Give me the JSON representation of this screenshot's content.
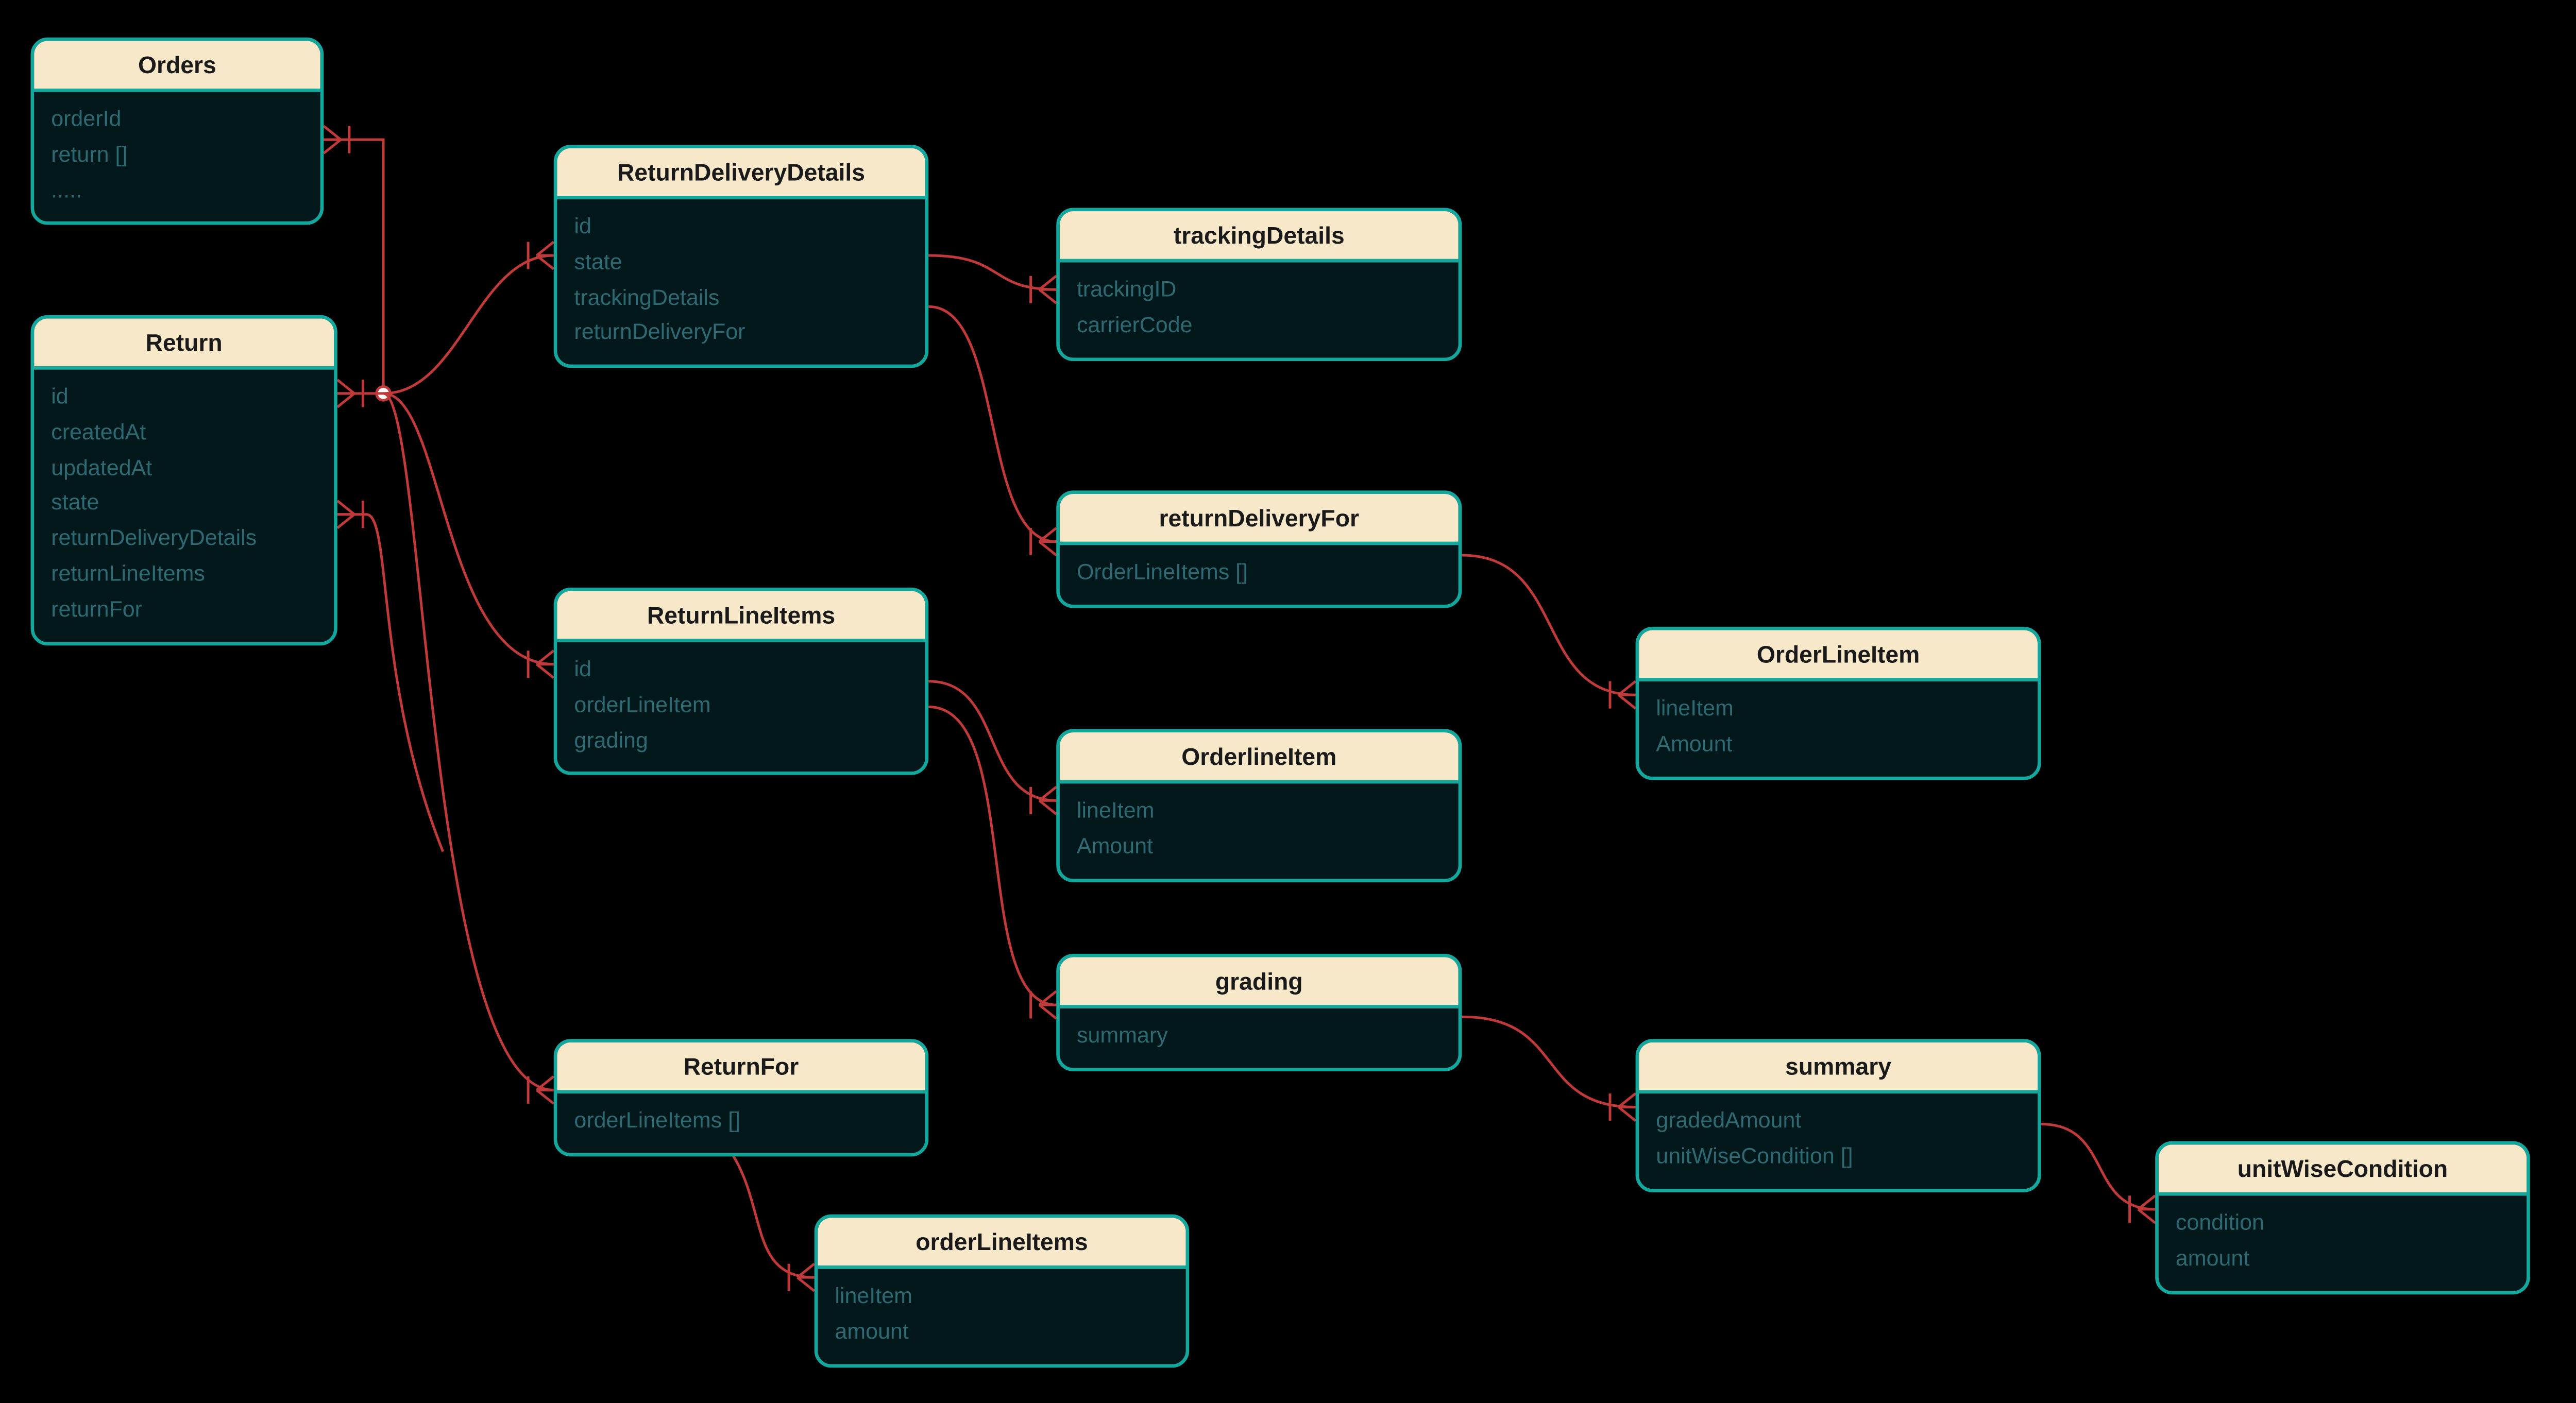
{
  "colors": {
    "background": "#000000",
    "border": "#13a89e",
    "header_bg": "#f6e8c8",
    "field_text": "#2d6a74",
    "connector": "#c13a3a"
  },
  "entities": {
    "orders": {
      "title": "Orders",
      "fields": [
        "orderId",
        "return []",
        "....."
      ]
    },
    "return": {
      "title": "Return",
      "fields": [
        "id",
        "createdAt",
        "updatedAt",
        "state",
        "returnDeliveryDetails",
        "returnLineItems",
        "returnFor"
      ]
    },
    "returnDeliveryDetails": {
      "title": "ReturnDeliveryDetails",
      "fields": [
        "id",
        "state",
        "trackingDetails",
        "returnDeliveryFor"
      ]
    },
    "returnLineItems": {
      "title": "ReturnLineItems",
      "fields": [
        "id",
        "orderLineItem",
        "grading"
      ]
    },
    "returnFor": {
      "title": "ReturnFor",
      "fields": [
        "orderLineItems []"
      ]
    },
    "trackingDetails": {
      "title": "trackingDetails",
      "fields": [
        "trackingID",
        "carrierCode"
      ]
    },
    "returnDeliveryFor": {
      "title": "returnDeliveryFor",
      "fields": [
        "OrderLineItems []"
      ]
    },
    "orderlineItem_lc": {
      "title": "OrderlineItem",
      "fields": [
        "lineItem",
        "Amount"
      ]
    },
    "grading": {
      "title": "grading",
      "fields": [
        "summary"
      ]
    },
    "orderLineItem_uc": {
      "title": "OrderLineItem",
      "fields": [
        "lineItem",
        "Amount"
      ]
    },
    "summary": {
      "title": "summary",
      "fields": [
        "gradedAmount",
        "unitWiseCondition []"
      ]
    },
    "orderLineItems": {
      "title": "orderLineItems",
      "fields": [
        "lineItem",
        "amount"
      ]
    },
    "unitWiseCondition": {
      "title": "unitWiseCondition",
      "fields": [
        "condition",
        "amount"
      ]
    }
  }
}
